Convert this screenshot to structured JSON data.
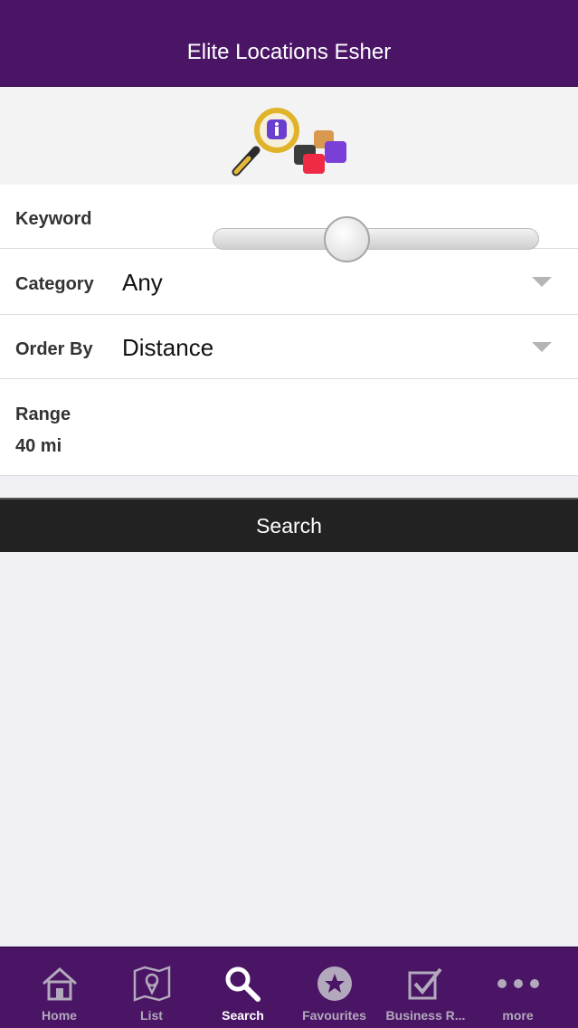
{
  "navbar": {
    "title": "Elite Locations Esher"
  },
  "form": {
    "keyword": {
      "label": "Keyword",
      "value": ""
    },
    "category": {
      "label": "Category",
      "value": "Any"
    },
    "order_by": {
      "label": "Order By",
      "value": "Distance"
    },
    "range": {
      "label": "Range",
      "value_text": "40 mi",
      "slider_fraction": 0.4
    }
  },
  "search_button": {
    "label": "Search"
  },
  "tabbar": {
    "tabs": [
      {
        "label": "Home",
        "icon": "home-icon",
        "active": false
      },
      {
        "label": "List",
        "icon": "map-pin-icon",
        "active": false
      },
      {
        "label": "Search",
        "icon": "search-icon",
        "active": true
      },
      {
        "label": "Favourites",
        "icon": "star-icon",
        "active": false
      },
      {
        "label": "Business R...",
        "icon": "checkbox-icon",
        "active": false
      },
      {
        "label": "more",
        "icon": "more-dots-icon",
        "active": false
      }
    ]
  },
  "colors": {
    "brand": "#4a1565",
    "button": "#222223",
    "background": "#efeff4"
  }
}
